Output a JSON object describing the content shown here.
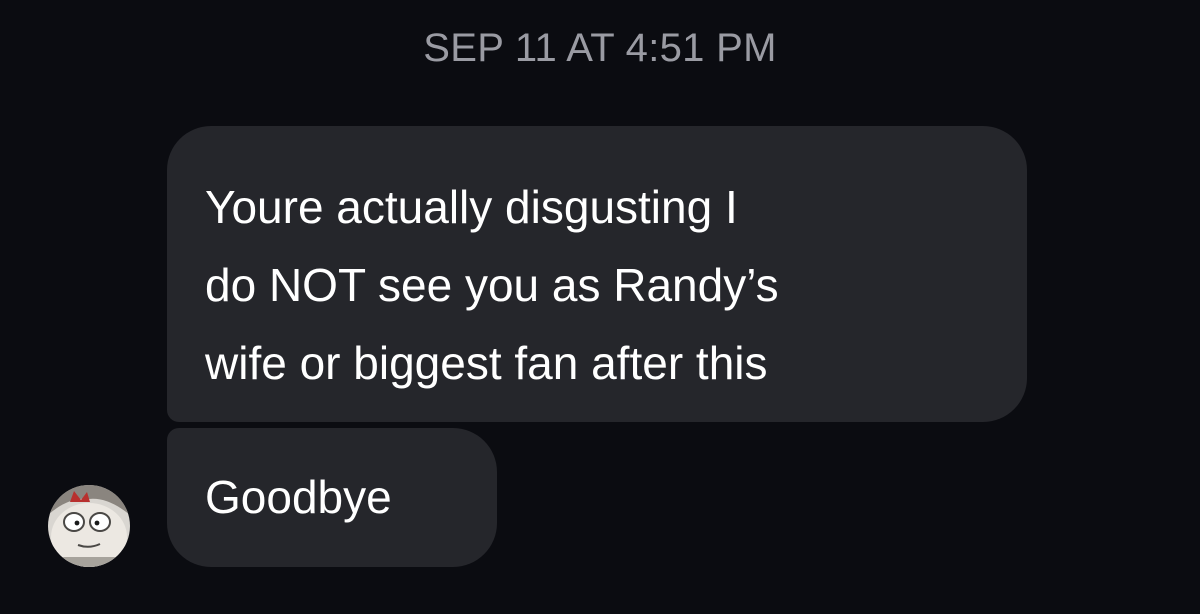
{
  "conversation": {
    "timestamp": "SEP 11 AT 4:51 PM",
    "messages": [
      {
        "lines": [
          "Youre actually disgusting I",
          "do NOT see you as Randy’s",
          "wife or biggest fan after this"
        ]
      },
      {
        "text": "Goodbye"
      }
    ],
    "sender_avatar": {
      "icon": "cartoon-face-avatar-icon"
    }
  },
  "colors": {
    "background": "#0b0c11",
    "bubble": "#25262b",
    "timestamp_text": "#9a9ba3",
    "message_text": "#ffffff"
  }
}
